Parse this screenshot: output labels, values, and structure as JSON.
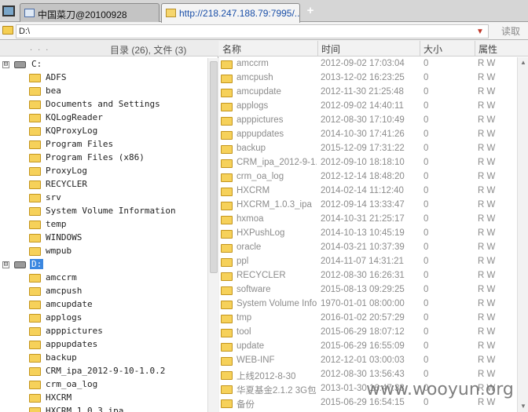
{
  "tabs": [
    {
      "label": "中国菜刀@20100928"
    },
    {
      "label": "http://218.247.188.79:7995/..."
    }
  ],
  "tab_add_symbol": "+",
  "path_bar": {
    "value": "D:\\",
    "read_label": "读取"
  },
  "left_panel": {
    "dots": ". . .",
    "summary": "目录 (26), 文件 (3)",
    "drives": [
      {
        "label": "C:",
        "expander": "⊟",
        "selected": false,
        "folders": [
          "ADFS",
          "bea",
          "Documents and Settings",
          "KQLogReader",
          "KQProxyLog",
          "Program Files",
          "Program Files (x86)",
          "ProxyLog",
          "RECYCLER",
          "srv",
          "System Volume Information",
          "temp",
          "WINDOWS",
          "wmpub"
        ]
      },
      {
        "label": "D:",
        "expander": "⊟",
        "selected": true,
        "folders": [
          "amccrm",
          "amcpush",
          "amcupdate",
          "applogs",
          "apppictures",
          "appupdates",
          "backup",
          "CRM_ipa_2012-9-10-1.0.2",
          "crm_oa_log",
          "HXCRM",
          "HXCRM_1.0.3_ipa"
        ]
      }
    ]
  },
  "file_list": {
    "columns": [
      "名称",
      "时间",
      "大小",
      "属性"
    ],
    "rows": [
      {
        "name": "amccrm",
        "time": "2012-09-02 17:03:04",
        "size": "0",
        "attr": "R W"
      },
      {
        "name": "amcpush",
        "time": "2013-12-02 16:23:25",
        "size": "0",
        "attr": "R W"
      },
      {
        "name": "amcupdate",
        "time": "2012-11-30 21:25:48",
        "size": "0",
        "attr": "R W"
      },
      {
        "name": "applogs",
        "time": "2012-09-02 14:40:11",
        "size": "0",
        "attr": "R W"
      },
      {
        "name": "apppictures",
        "time": "2012-08-30 17:10:49",
        "size": "0",
        "attr": "R W"
      },
      {
        "name": "appupdates",
        "time": "2014-10-30 17:41:26",
        "size": "0",
        "attr": "R W"
      },
      {
        "name": "backup",
        "time": "2015-12-09 17:31:22",
        "size": "0",
        "attr": "R W"
      },
      {
        "name": "CRM_ipa_2012-9-1...",
        "time": "2012-09-10 18:18:10",
        "size": "0",
        "attr": "R W"
      },
      {
        "name": "crm_oa_log",
        "time": "2012-12-14 18:48:20",
        "size": "0",
        "attr": "R W"
      },
      {
        "name": "HXCRM",
        "time": "2014-02-14 11:12:40",
        "size": "0",
        "attr": "R W"
      },
      {
        "name": "HXCRM_1.0.3_ipa",
        "time": "2012-09-14 13:33:47",
        "size": "0",
        "attr": "R W"
      },
      {
        "name": "hxmoa",
        "time": "2014-10-31 21:25:17",
        "size": "0",
        "attr": "R W"
      },
      {
        "name": "HXPushLog",
        "time": "2014-10-13 10:45:19",
        "size": "0",
        "attr": "R W"
      },
      {
        "name": "oracle",
        "time": "2014-03-21 10:37:39",
        "size": "0",
        "attr": "R W"
      },
      {
        "name": "ppl",
        "time": "2014-11-07 14:31:21",
        "size": "0",
        "attr": "R W"
      },
      {
        "name": "RECYCLER",
        "time": "2012-08-30 16:26:31",
        "size": "0",
        "attr": "R W"
      },
      {
        "name": "software",
        "time": "2015-08-13 09:29:25",
        "size": "0",
        "attr": "R W"
      },
      {
        "name": "System Volume Info...",
        "time": "1970-01-01 08:00:00",
        "size": "0",
        "attr": "R W"
      },
      {
        "name": "tmp",
        "time": "2016-01-02 20:57:29",
        "size": "0",
        "attr": "R W"
      },
      {
        "name": "tool",
        "time": "2015-06-29 18:07:12",
        "size": "0",
        "attr": "R W"
      },
      {
        "name": "update",
        "time": "2015-06-29 16:55:09",
        "size": "0",
        "attr": "R W"
      },
      {
        "name": "WEB-INF",
        "time": "2012-12-01 03:00:03",
        "size": "0",
        "attr": "R W"
      },
      {
        "name": "上线2012-8-30",
        "time": "2012-08-30 13:56:43",
        "size": "0",
        "attr": "R W"
      },
      {
        "name": "华夏基金2.1.2 3G包",
        "time": "2013-01-30 16:47:33",
        "size": "0",
        "attr": "R W"
      },
      {
        "name": "备份",
        "time": "2015-06-29 16:54:15",
        "size": "0",
        "attr": "R W"
      }
    ]
  },
  "watermark": "www.wooyun.org"
}
